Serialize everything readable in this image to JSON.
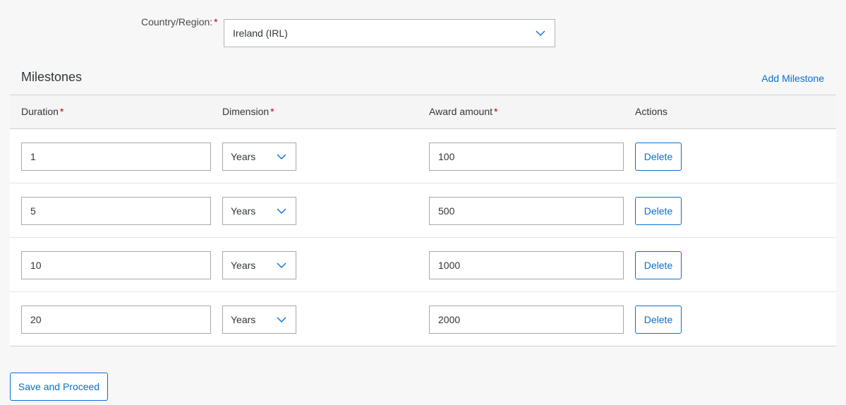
{
  "country": {
    "label": "Country/Region:",
    "required_marker": "*",
    "selected": "Ireland (IRL)",
    "dropdown_icon": "chevron-down-icon"
  },
  "milestones": {
    "title": "Milestones",
    "add_label": "Add Milestone",
    "columns": {
      "duration": "Duration",
      "dimension": "Dimension",
      "award": "Award amount",
      "actions": "Actions",
      "required_marker": "*"
    },
    "rows": [
      {
        "duration": "1",
        "dimension": "Years",
        "award": "100",
        "action": "Delete"
      },
      {
        "duration": "5",
        "dimension": "Years",
        "award": "500",
        "action": "Delete"
      },
      {
        "duration": "10",
        "dimension": "Years",
        "award": "1000",
        "action": "Delete"
      },
      {
        "duration": "20",
        "dimension": "Years",
        "award": "2000",
        "action": "Delete"
      }
    ]
  },
  "footer": {
    "save_label": "Save and Proceed"
  },
  "colors": {
    "accent": "#0a6ed1",
    "required": "#bb0000",
    "background": "#f7f7f7"
  }
}
